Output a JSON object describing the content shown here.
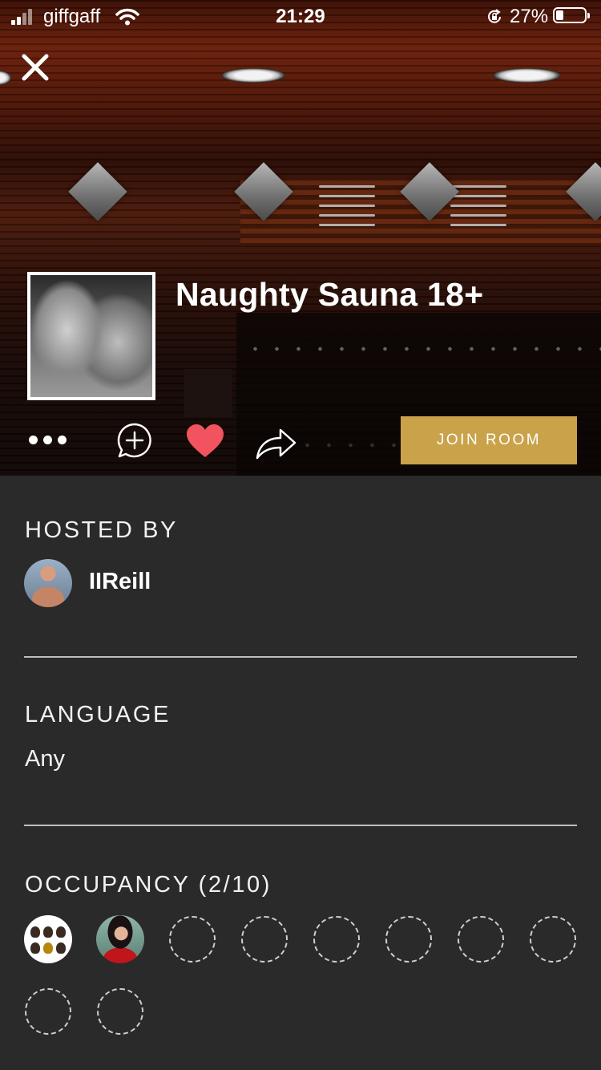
{
  "status_bar": {
    "carrier": "giffgaff",
    "time": "21:29",
    "battery_percent": "27%",
    "battery_level": 0.27,
    "icons": [
      "signal-icon",
      "wifi-icon",
      "orientation-lock-icon",
      "battery-icon"
    ]
  },
  "hero": {
    "close_icon": "close-icon",
    "room_title": "Naughty Sauna 18+",
    "actions": {
      "more_icon": "more-dots-icon",
      "add_icon": "add-chat-icon",
      "favorite_icon": "heart-icon",
      "share_icon": "share-icon"
    },
    "join_button": "JOIN ROOM"
  },
  "details": {
    "hosted_by_label": "HOSTED BY",
    "host_name": "IIReill",
    "language_label": "LANGUAGE",
    "language_value": "Any",
    "occupancy_label": "OCCUPANCY (2/10)",
    "occupied_seats": 2,
    "total_seats": 10
  },
  "colors": {
    "accent_gold": "#c9a24a",
    "heart_red": "#f1545f",
    "background": "#2a2a2a",
    "divider": "#bdbdbd"
  }
}
